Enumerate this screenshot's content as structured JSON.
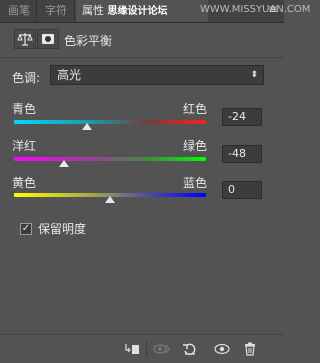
{
  "tabs": [
    {
      "label": "画笔"
    },
    {
      "label": "字符"
    },
    {
      "label": "属性"
    }
  ],
  "watermark": "思缘设计论坛",
  "watermark_tail": "WWW.MISSYUAN.COM",
  "panel_menu": "≡",
  "header": {
    "title": "色彩平衡",
    "adjustment_icon": "balance-scale-icon",
    "mask_icon": "layer-mask-icon"
  },
  "tone": {
    "label": "色调:",
    "value": "高光",
    "options_arrow": "⬍"
  },
  "sliders": [
    {
      "left_label": "青色",
      "right_label": "红色",
      "value": "-24",
      "numeric": -24
    },
    {
      "left_label": "洋红",
      "right_label": "绿色",
      "value": "-48",
      "numeric": -48
    },
    {
      "left_label": "黄色",
      "right_label": "蓝色",
      "value": "0",
      "numeric": 0
    }
  ],
  "preserve_luminosity": {
    "label": "保留明度",
    "checked": true,
    "mark": "✓"
  },
  "footer": {
    "clip_icon": "clip-to-layer-icon",
    "view_previous_icon": "view-previous-icon",
    "reset_icon": "reset-icon",
    "visibility_icon": "eye-icon",
    "delete_icon": "trash-icon"
  },
  "colors": {
    "panel_bg": "#535353",
    "tab_bg": "#424242",
    "field_bg": "#3c3c3c"
  }
}
